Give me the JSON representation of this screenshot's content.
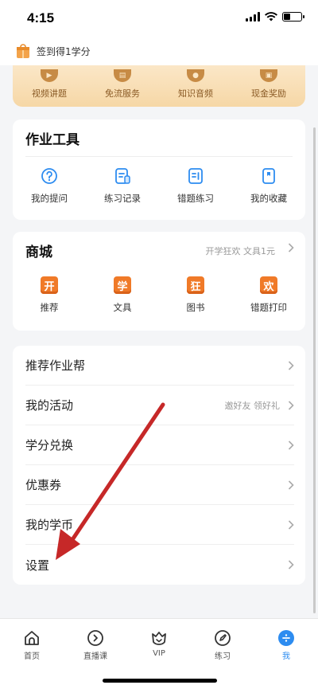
{
  "status": {
    "time": "4:15"
  },
  "signin": {
    "text": "签到得1学分"
  },
  "benefits": [
    {
      "label": "视频讲题",
      "icon": "video-icon"
    },
    {
      "label": "免流服务",
      "icon": "sim-icon"
    },
    {
      "label": "知识音频",
      "icon": "bell-icon"
    },
    {
      "label": "现金奖励",
      "icon": "gift-icon"
    }
  ],
  "tools": {
    "title": "作业工具",
    "items": [
      {
        "label": "我的提问",
        "icon": "question-icon"
      },
      {
        "label": "练习记录",
        "icon": "practice-record-icon"
      },
      {
        "label": "错题练习",
        "icon": "wrong-question-icon"
      },
      {
        "label": "我的收藏",
        "icon": "bookmark-icon"
      }
    ]
  },
  "mall": {
    "title": "商城",
    "promo": "开学狂欢 文具1元",
    "items": [
      {
        "label": "推荐",
        "glyph": "开"
      },
      {
        "label": "文具",
        "glyph": "学"
      },
      {
        "label": "图书",
        "glyph": "狂"
      },
      {
        "label": "错题打印",
        "glyph": "欢"
      }
    ]
  },
  "menu": [
    {
      "label": "推荐作业帮",
      "hint": ""
    },
    {
      "label": "我的活动",
      "hint": "邀好友 领好礼"
    },
    {
      "label": "学分兑换",
      "hint": ""
    },
    {
      "label": "优惠券",
      "hint": ""
    },
    {
      "label": "我的学币",
      "hint": ""
    },
    {
      "label": "设置",
      "hint": ""
    }
  ],
  "tabbar": [
    {
      "label": "首页",
      "icon": "home-icon",
      "active": false
    },
    {
      "label": "直播课",
      "icon": "live-icon",
      "active": false
    },
    {
      "label": "VIP",
      "icon": "vip-icon",
      "active": false
    },
    {
      "label": "练习",
      "icon": "practice-icon",
      "active": false
    },
    {
      "label": "我",
      "icon": "me-icon",
      "active": true
    }
  ],
  "colors": {
    "accent": "#2d8cf0",
    "mall_orange": "#f07a28",
    "annotation": "#c62828"
  }
}
